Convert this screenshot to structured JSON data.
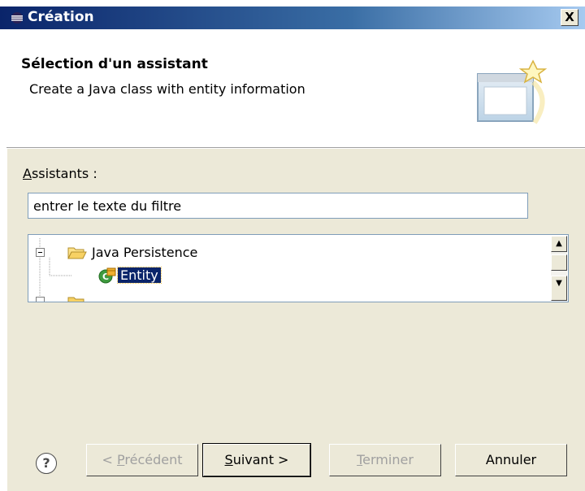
{
  "window": {
    "title": "Création",
    "close_label": "X"
  },
  "banner": {
    "title": "Sélection d'un assistant",
    "description": "Create a Java class with entity information"
  },
  "wizards": {
    "label_mnemonic": "A",
    "label_rest": "ssistants :",
    "filter_value": "entrer le texte du filtre"
  },
  "tree": {
    "items": [
      {
        "label": "Java Persistence",
        "expanded": true,
        "icon": "folder-open-icon"
      },
      {
        "label": "Entity",
        "selected": true,
        "icon": "entity-class-icon"
      }
    ],
    "selection_bg": "#0a246a"
  },
  "buttons": {
    "help": "?",
    "back": {
      "mnemonic": "P",
      "prefix": "< ",
      "rest": "récédent"
    },
    "next": {
      "mnemonic": "S",
      "rest": "uivant >"
    },
    "finish": {
      "mnemonic": "T",
      "rest": "erminer"
    },
    "cancel": "Annuler"
  },
  "colors": {
    "title_bar_start": "#0a246a",
    "title_bar_end": "#a6caf0",
    "dialog_bg": "#ece9d8"
  }
}
